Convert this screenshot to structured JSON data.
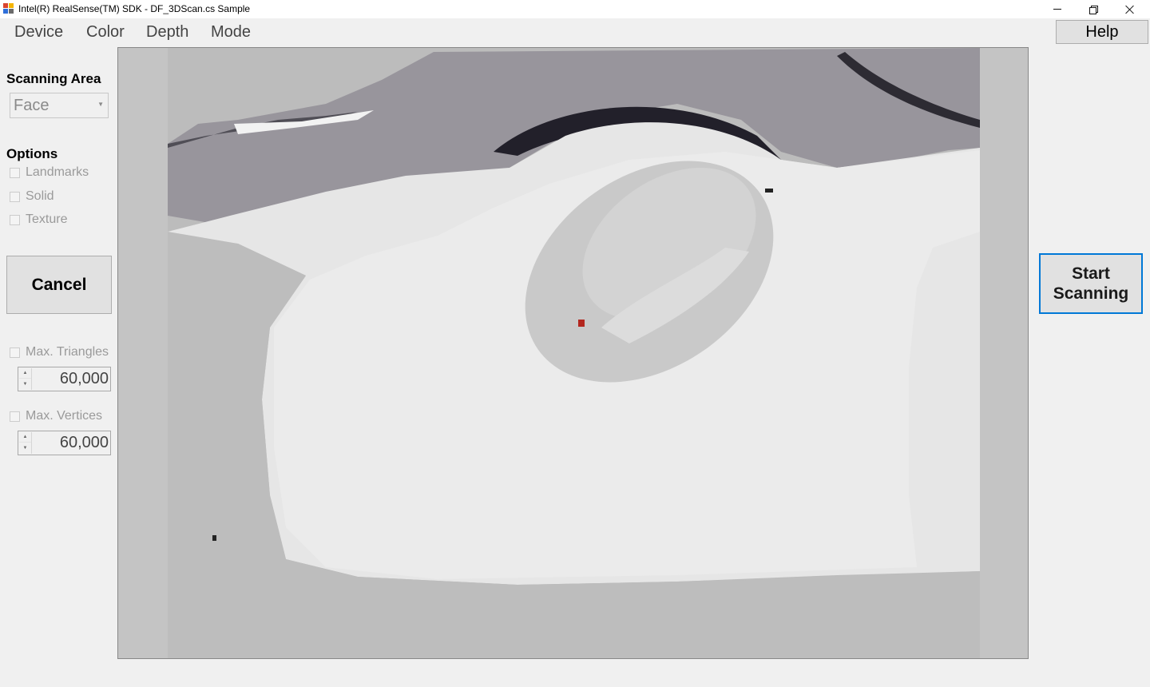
{
  "window": {
    "title": "Intel(R) RealSense(TM) SDK - DF_3DScan.cs Sample",
    "icon": "app-icon",
    "controls": [
      "minimize-icon",
      "restore-icon",
      "close-icon"
    ]
  },
  "menu": {
    "items": [
      "Device",
      "Color",
      "Depth",
      "Mode"
    ],
    "help_label": "Help"
  },
  "scanning_area": {
    "heading": "Scanning Area",
    "selected": "Face"
  },
  "options": {
    "heading": "Options",
    "items": [
      {
        "label": "Landmarks",
        "checked": false,
        "enabled": false
      },
      {
        "label": "Solid",
        "checked": false,
        "enabled": false
      },
      {
        "label": "Texture",
        "checked": false,
        "enabled": false
      }
    ]
  },
  "cancel_label": "Cancel",
  "limits": {
    "max_triangles": {
      "label": "Max. Triangles",
      "checked": false,
      "value": "60,000"
    },
    "max_vertices": {
      "label": "Max. Vertices",
      "checked": false,
      "value": "60,000"
    }
  },
  "start_button": {
    "line1": "Start",
    "line2": "Scanning"
  },
  "colors": {
    "accent": "#0078d7",
    "window_bg": "#f0f0f0",
    "disabled_text": "#9a9a9a",
    "depth_marker": "#b3261e"
  }
}
